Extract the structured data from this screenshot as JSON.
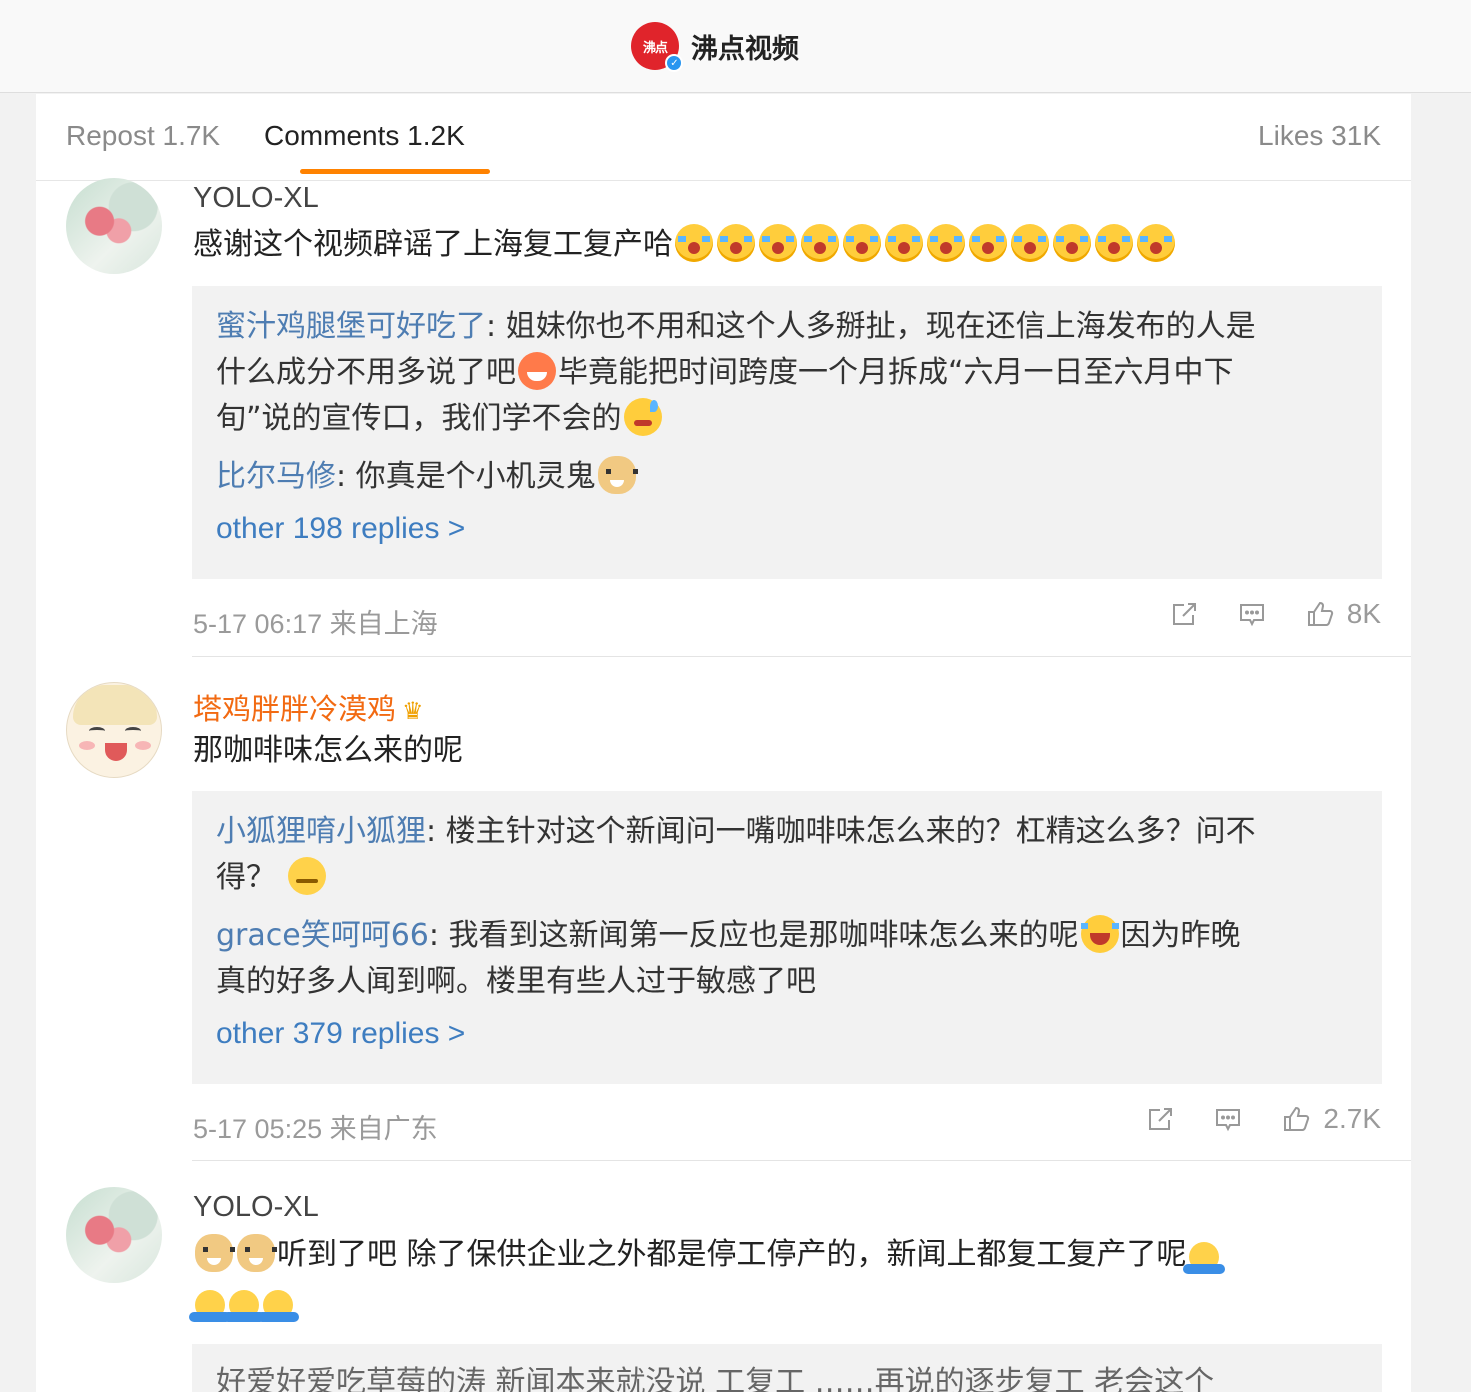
{
  "header": {
    "logo_text": "沸点",
    "account_name": "沸点视频"
  },
  "tabs": {
    "repost": "Repost 1.7K",
    "comments": "Comments 1.2K",
    "likes": "Likes 31K"
  },
  "comments": [
    {
      "username": "YOLO-XL",
      "text": "感谢这个视频辟谣了上海复工复产哈",
      "replies": [
        {
          "name": "蜜汁鸡腿堡可好吃了",
          "line1": "姐妹你也不用和这个人多掰扯，现在还信上海发布的人是",
          "line2a": "什么成分不用多说了吧",
          "line2b": "毕竟能把时间跨度一个月拆成“六月一日至六月中下",
          "line3": "旬”说的宣传口，我们学不会的"
        },
        {
          "name": "比尔马修",
          "text": "你真是个小机灵鬼"
        }
      ],
      "more": "other 198 replies >",
      "meta": "5-17 06:17 来自上海",
      "likes": "8K"
    },
    {
      "username": "塔鸡胖胖冷漠鸡",
      "text": "那咖啡味怎么来的呢",
      "replies": [
        {
          "name": "小狐狸唷小狐狸",
          "line1": "楼主针对这个新闻问一嘴咖啡味怎么来的？杠精这么多？问不",
          "line2": "得？"
        },
        {
          "name": "grace笑呵呵66",
          "line1": "我看到这新闻第一反应也是那咖啡味怎么来的呢",
          "line1b": "因为昨晚",
          "line2": "真的好多人闻到啊。楼里有些人过于敏感了吧"
        }
      ],
      "more": "other 379 replies >",
      "meta": "5-17 05:25 来自广东",
      "likes": "2.7K"
    },
    {
      "username": "YOLO-XL",
      "text": "听到了吧 除了保供企业之外都是停工停产的，新闻上都复工复产了呢",
      "partial_reply": "好爱好爱吃草莓的涛  新闻本来就没说   工复工 ……再说的逐步复工  老会这个"
    }
  ]
}
